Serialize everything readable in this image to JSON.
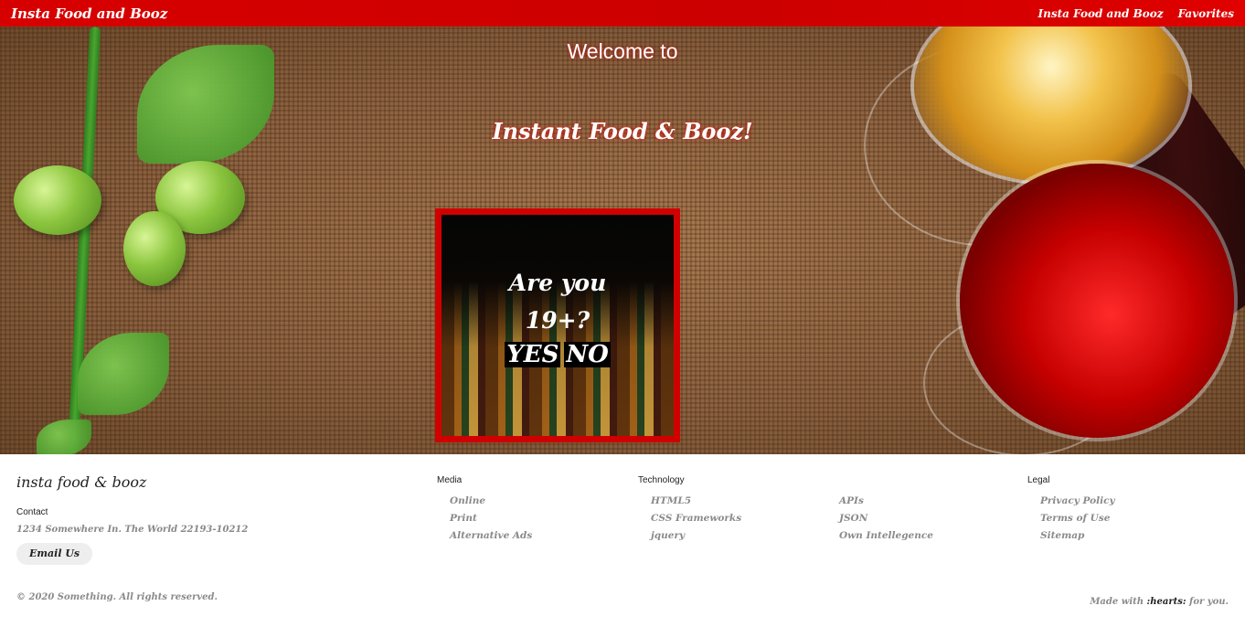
{
  "nav": {
    "brand": "Insta Food and Booz",
    "links": [
      "Insta Food and Booz",
      "Favorites"
    ],
    "accent": "#d70000"
  },
  "hero": {
    "welcome": "Welcome to",
    "title": "Instant Food & Booz!"
  },
  "age_gate": {
    "question": "Are you 19+?",
    "yes": "YES",
    "no": "NO",
    "border_color": "#d10000"
  },
  "footer": {
    "brand": "insta food & booz",
    "contact_heading": "Contact",
    "address": "1234 Somewhere In. The World 22193-10212",
    "email_button": "Email Us",
    "columns": [
      {
        "heading": "Media",
        "items": [
          "Online",
          "Print",
          "Alternative Ads"
        ]
      },
      {
        "heading": "Technology",
        "items": [
          "HTML5",
          "CSS Frameworks",
          "jquery"
        ]
      },
      {
        "heading": "",
        "items": [
          "APIs",
          "JSON",
          "Own Intellegence"
        ]
      },
      {
        "heading": "Legal",
        "items": [
          "Privacy Policy",
          "Terms of Use",
          "Sitemap"
        ]
      }
    ],
    "copyright": "© 2020 Something. All rights reserved.",
    "made_with_prefix": "Made with",
    "made_with_emoji": ":hearts:",
    "made_with_suffix": "for you."
  }
}
